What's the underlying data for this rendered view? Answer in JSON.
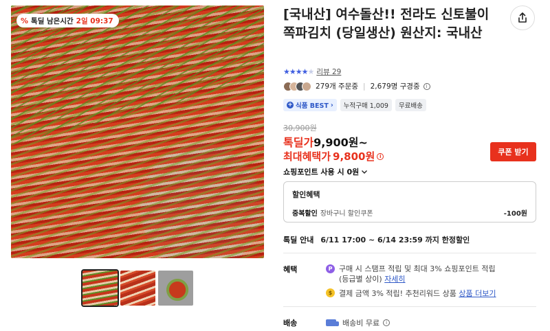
{
  "product": {
    "title": "[국내산] 여수돌산!! 전라도 신토불이 쪽파김치 (당일생산) 원산지: 국내산",
    "timer_badge": {
      "icon_glyph": "%",
      "prefix": "톡딜 남은시간",
      "remaining": "2일 09:37"
    },
    "rating": {
      "stars": 4.5,
      "review_label": "리뷰 29"
    },
    "social": {
      "orders": "279개 주문중",
      "subscribers": "2,679명 구경중"
    },
    "tags": [
      {
        "label": "식품 BEST",
        "style": "best"
      },
      {
        "label": "누적구매 1,009",
        "style": "plain"
      },
      {
        "label": "무료배송",
        "style": "plain"
      }
    ],
    "original_price": "30,900원",
    "deal_price_label": "톡딜가",
    "deal_price": "9,900원~",
    "max_benefit_label": "최대혜택가",
    "max_benefit_price": "9,800원",
    "coupon_button": "쿠폰 받기",
    "points_label": "쇼핑포인트 사용 시 0원",
    "discount": {
      "header": "할인혜택",
      "name": "중복할인",
      "desc": "장바구니 할인쿠폰",
      "amount": "-100원"
    },
    "deal_info": {
      "label": "톡딜 안내",
      "value": "6/11 17:00 ~ 6/14 23:59 까지 한정할인"
    },
    "benefits": {
      "label": "혜택",
      "line1": "구매 시 스탬프 적립 및 최대 3% 쇼핑포인트 적립",
      "line1_sub": "(등급별 상이)",
      "line1_link": "자세히",
      "line2": "결제 금액 3% 적립! 추천리워드 상품",
      "line2_link": "상품 더보기"
    },
    "shipping": {
      "label": "배송",
      "value": "배송비 무료"
    }
  },
  "colors": {
    "accent_red": "#e8311d",
    "accent_blue": "#2e58c7",
    "star_blue": "#3f5ee0"
  },
  "icons": [
    "share-icon",
    "info-icon",
    "chevron-down-icon",
    "points-icon",
    "reward-icon",
    "truck-icon"
  ]
}
